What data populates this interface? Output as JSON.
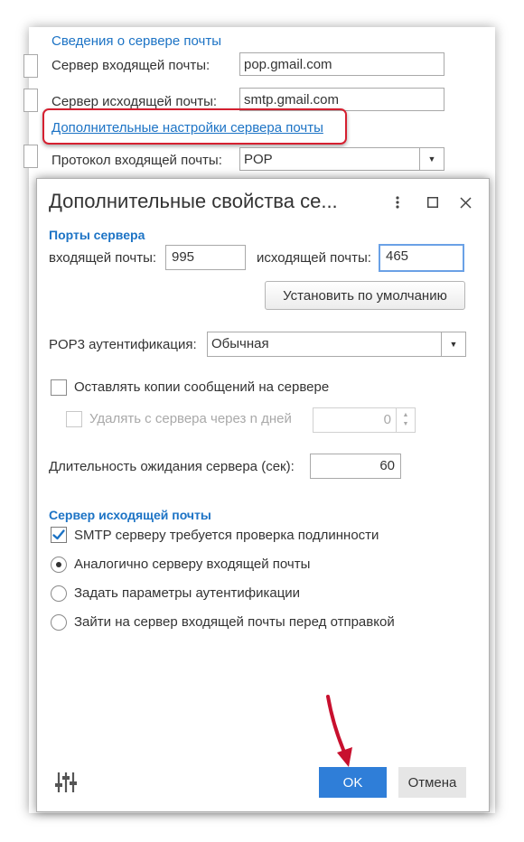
{
  "background_form": {
    "section_title": "Сведения о сервере почты",
    "incoming_label": "Сервер входящей почты:",
    "incoming_value": "pop.gmail.com",
    "outgoing_label": "Сервер исходящей почты:",
    "outgoing_value": "smtp.gmail.com",
    "advanced_link": "Дополнительные настройки сервера почты",
    "protocol_label": "Протокол входящей почты:",
    "protocol_value": "POP"
  },
  "dialog": {
    "title": "Дополнительные свойства се...",
    "ports_section": "Порты сервера",
    "incoming_port_label": "входящей почты:",
    "incoming_port_value": "995",
    "outgoing_port_label": "исходящей почты:",
    "outgoing_port_value": "465",
    "default_button": "Установить по умолчанию",
    "pop3_auth_label": "POP3 аутентификация:",
    "pop3_auth_value": "Обычная",
    "keep_copies_label": "Оставлять копии сообщений на сервере",
    "keep_copies_checked": false,
    "delete_after_label": "Удалять с сервера через n дней",
    "delete_after_value": "0",
    "timeout_label": "Длительность ожидания сервера (сек):",
    "timeout_value": "60",
    "outgoing_section": "Сервер исходящей почты",
    "smtp_auth_label": "SMTP серверу требуется проверка подлинности",
    "smtp_auth_checked": true,
    "radio_same_label": "Аналогично серверу входящей почты",
    "radio_custom_label": "Задать параметры аутентификации",
    "radio_pop_before_label": "Зайти на сервер входящей почты перед отправкой",
    "radio_selected": "same",
    "ok_button": "OK",
    "cancel_button": "Отмена"
  },
  "colors": {
    "accent_blue": "#1c73c5",
    "ok_button": "#2f7ed8",
    "highlight_red": "#d52030",
    "arrow_red": "#c8102e"
  }
}
